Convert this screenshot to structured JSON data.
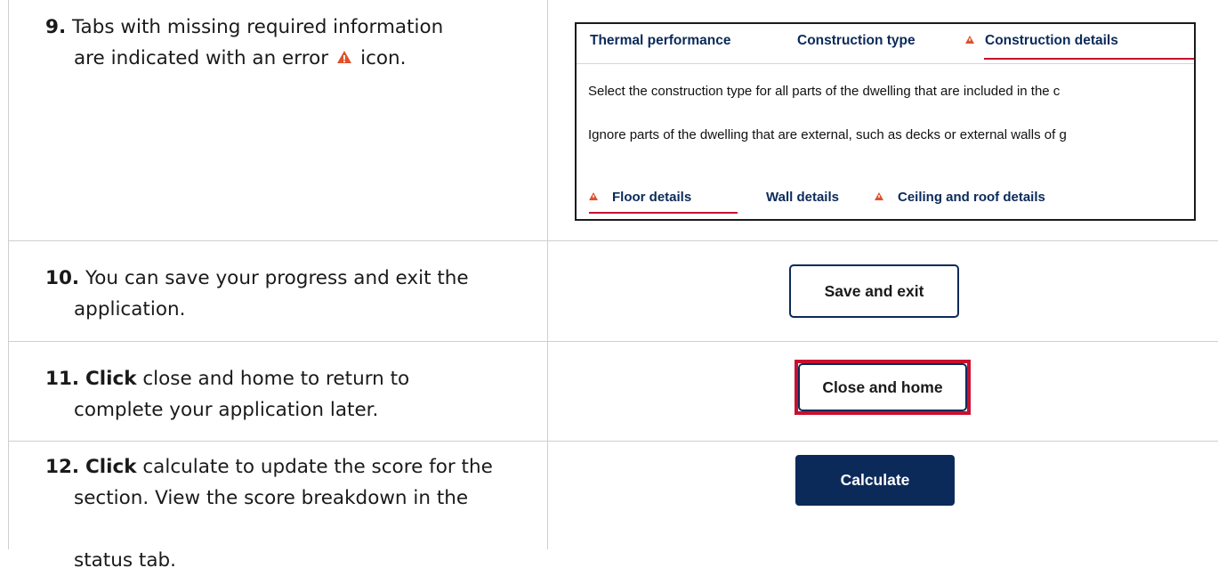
{
  "steps": [
    {
      "num": "9.",
      "text_a": "Tabs with missing required information",
      "text_b": "are indicated with an error",
      "text_c": "icon."
    },
    {
      "num": "10.",
      "text_a": "You can save your progress and exit the",
      "text_b": "application."
    },
    {
      "num": "11.",
      "emph": "Click",
      "text_a": "close and home to return to",
      "text_b": "complete your application later."
    },
    {
      "num": "12.",
      "emph": "Click",
      "text_a": "calculate to update the score for the",
      "text_b": "section. View the score breakdown in the",
      "text_c": "status tab."
    }
  ],
  "panel": {
    "tabs": [
      "Thermal performance",
      "Construction type",
      "Construction details"
    ],
    "text_lines": [
      "Select the construction type for all parts of the dwelling that are included in the c",
      "Ignore parts of the dwelling that are external, such as decks or external walls of g"
    ],
    "subtabs": [
      "Floor details",
      "Wall details",
      "Ceiling and roof details"
    ]
  },
  "buttons": {
    "save_exit": "Save and exit",
    "close_home": "Close and home",
    "calculate": "Calculate"
  },
  "colors": {
    "navy": "#0b2a5a",
    "error_red": "#c8102e",
    "warning_orange": "#e0502a"
  },
  "icons": {
    "error": "warning-triangle-icon"
  }
}
